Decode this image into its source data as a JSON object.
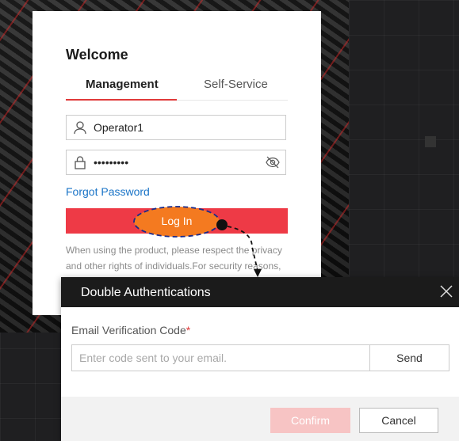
{
  "login": {
    "welcome": "Welcome",
    "tabs": [
      {
        "label": "Management",
        "active": true
      },
      {
        "label": "Self-Service",
        "active": false
      }
    ],
    "username_value": "Operator1",
    "password_masked": "•••••••••",
    "forgot_label": "Forgot Password",
    "login_label": "Log In",
    "notice": "When using the product, please respect the privacy and other rights of individuals.For security reasons,"
  },
  "dialog": {
    "title": "Double Authentications",
    "email_label": "Email Verification Code",
    "required_mark": "*",
    "code_placeholder": "Enter code sent to your email.",
    "send_label": "Send",
    "confirm_label": "Confirm",
    "cancel_label": "Cancel"
  },
  "colors": {
    "accent_red": "#ee3a46",
    "link_blue": "#1a74c7",
    "highlight_orange": "#f47a20",
    "header_dark": "#1b1b1b"
  },
  "icons": [
    "user-icon",
    "lock-icon",
    "eye-hidden-icon",
    "close-icon"
  ]
}
